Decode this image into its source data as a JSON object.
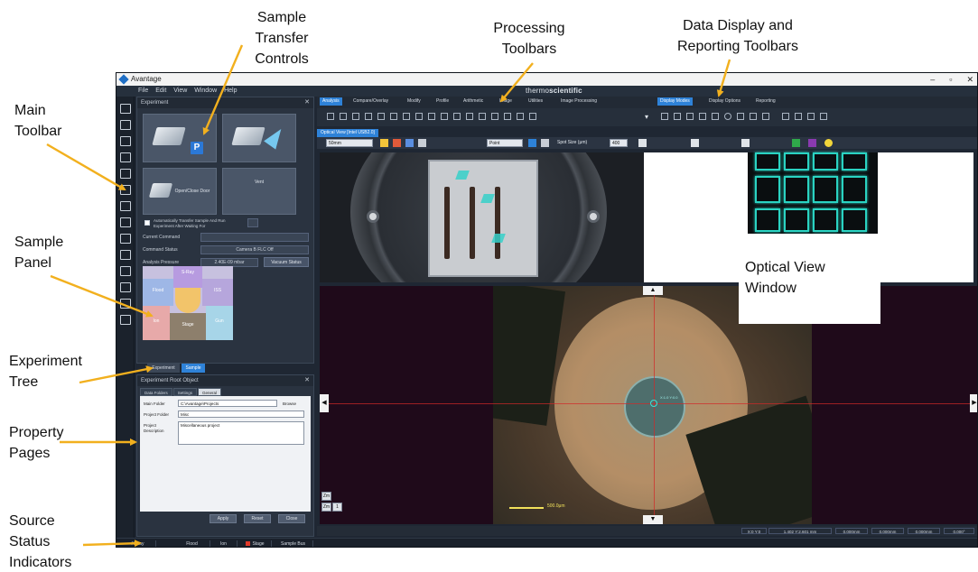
{
  "callouts": {
    "sample_transfer": [
      "Sample",
      "Transfer",
      "Controls"
    ],
    "processing": [
      "Processing",
      "Toolbars"
    ],
    "data_display": [
      "Data Display and",
      "Reporting Toolbars"
    ],
    "main_toolbar": [
      "Main",
      "Toolbar"
    ],
    "sample_panel": [
      "Sample",
      "Panel"
    ],
    "experiment_tree": [
      "Experiment",
      "Tree"
    ],
    "property_pages": [
      "Property",
      "Pages"
    ],
    "source_status": [
      "Source",
      "Status",
      "Indicators"
    ],
    "optical_view": [
      "Optical View",
      "Window"
    ]
  },
  "app": {
    "title": "Avantage",
    "window_buttons": [
      "–",
      "▫",
      "✕"
    ],
    "menu": [
      "File",
      "Edit",
      "View",
      "Window",
      "Help"
    ]
  },
  "experiment_panel": {
    "title": "Experiment",
    "close": "✕",
    "transfer_badge": "P",
    "open_close_door": "Open/Close Door",
    "vent": "Vent",
    "auto_transfer_text": "Automatically Transfer Sample And Run Experiment After Waiting For",
    "current_command_label": "Current Command",
    "current_command_value": "",
    "command_status_label": "Command Status",
    "command_status_value": "Camera B FLC Off",
    "analysis_pressure_label": "Analysis Pressure",
    "analysis_pressure_value": "2.40E-09 mbar",
    "vacuum_status": "Vacuum Status",
    "sample_segments": [
      "S-Ray",
      "Flood",
      "ISS",
      "Ion",
      "Gun",
      "Stage"
    ]
  },
  "tree_tabs": [
    "Experiment",
    "Sample"
  ],
  "property_panel": {
    "title": "Experiment Root Object",
    "close": "✕",
    "tabs": [
      "Data Folders",
      "Settings",
      "General"
    ],
    "main_folder_label": "Main Folder",
    "main_folder_value": "C:\\Avantage\\Projects",
    "browse": "Browse",
    "project_folder_label": "Project Folder",
    "project_folder_value": "Misc",
    "project_desc_label": "Project Description",
    "project_desc_value": "Miscellaneous project",
    "buttons": [
      "Apply",
      "Reset",
      "Close"
    ]
  },
  "status_bar": {
    "cells": [
      "X-Ray",
      "Flood",
      "Ion",
      "Stage",
      "Sample Bus"
    ],
    "red_label": "Stage"
  },
  "processing_tabs": [
    "Analysis",
    "Compare/Overlay",
    "Modify",
    "Profile",
    "Arithmetic",
    "Image",
    "Utilities",
    "Image Processing"
  ],
  "brand": {
    "light": "thermo",
    "bold": "scientific"
  },
  "data_display_tabs": [
    "Display Modes",
    "Display Options",
    "Reporting"
  ],
  "optical": {
    "tab": "Optical View [Intel USB2.0]",
    "zoom_select": "50mm",
    "mode_select": "Point",
    "spot_size_label": "Spot Size (μm)",
    "spot_size_value": "400",
    "scale_label": "500.0μm",
    "target_label": "X:1.0 Y:0.0",
    "zoom_buttons": [
      "Zm",
      "Zm",
      "1"
    ],
    "status_cells": [
      "X:0 Y:0",
      "1.402 Y:2.601 mm",
      "0.000mm",
      "0.000mm",
      "0.000mm",
      "0.000°"
    ]
  }
}
